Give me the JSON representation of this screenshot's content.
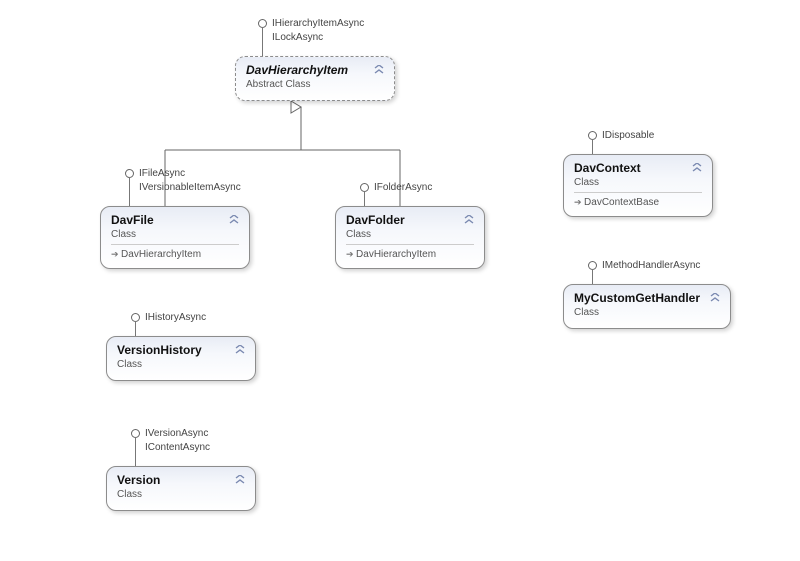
{
  "classes": {
    "davHierarchyItem": {
      "name": "DavHierarchyItem",
      "subtitle": "Abstract Class",
      "interfaces": [
        "IHierarchyItemAsync",
        "ILockAsync"
      ]
    },
    "davFile": {
      "name": "DavFile",
      "subtitle": "Class",
      "base": "DavHierarchyItem",
      "interfaces": [
        "IFileAsync",
        "IVersionableItemAsync"
      ]
    },
    "davFolder": {
      "name": "DavFolder",
      "subtitle": "Class",
      "base": "DavHierarchyItem",
      "interfaces": [
        "IFolderAsync"
      ]
    },
    "davContext": {
      "name": "DavContext",
      "subtitle": "Class",
      "base": "DavContextBase",
      "interfaces": [
        "IDisposable"
      ]
    },
    "myCustomGetHandler": {
      "name": "MyCustomGetHandler",
      "subtitle": "Class",
      "interfaces": [
        "IMethodHandlerAsync"
      ]
    },
    "versionHistory": {
      "name": "VersionHistory",
      "subtitle": "Class",
      "interfaces": [
        "IHistoryAsync"
      ]
    },
    "version": {
      "name": "Version",
      "subtitle": "Class",
      "interfaces": [
        "IVersionAsync",
        "IContentAsync"
      ]
    }
  },
  "chart_data": {
    "type": "uml-class-diagram",
    "nodes": [
      {
        "id": "DavHierarchyItem",
        "kind": "abstract-class",
        "implements": [
          "IHierarchyItemAsync",
          "ILockAsync"
        ]
      },
      {
        "id": "DavFile",
        "kind": "class",
        "extends": "DavHierarchyItem",
        "implements": [
          "IFileAsync",
          "IVersionableItemAsync"
        ]
      },
      {
        "id": "DavFolder",
        "kind": "class",
        "extends": "DavHierarchyItem",
        "implements": [
          "IFolderAsync"
        ]
      },
      {
        "id": "DavContext",
        "kind": "class",
        "extends": "DavContextBase",
        "implements": [
          "IDisposable"
        ]
      },
      {
        "id": "MyCustomGetHandler",
        "kind": "class",
        "implements": [
          "IMethodHandlerAsync"
        ]
      },
      {
        "id": "VersionHistory",
        "kind": "class",
        "implements": [
          "IHistoryAsync"
        ]
      },
      {
        "id": "Version",
        "kind": "class",
        "implements": [
          "IVersionAsync",
          "IContentAsync"
        ]
      }
    ],
    "inheritance_edges": [
      {
        "from": "DavFile",
        "to": "DavHierarchyItem"
      },
      {
        "from": "DavFolder",
        "to": "DavHierarchyItem"
      }
    ]
  }
}
